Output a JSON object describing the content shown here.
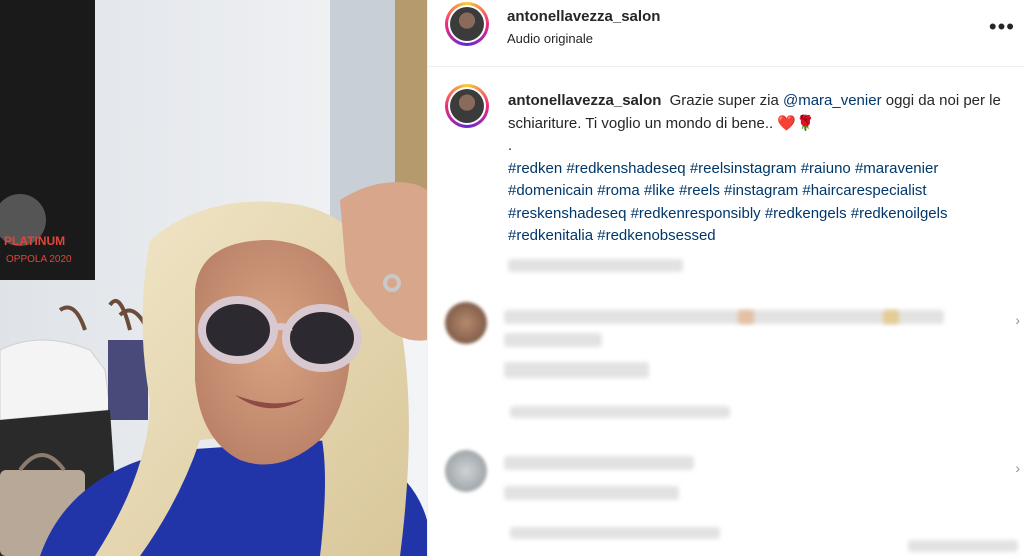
{
  "post": {
    "username": "antonellavezza_salon",
    "subtitle": "Audio originale",
    "more_label": "•••"
  },
  "caption": {
    "username": "antonellavezza_salon",
    "text_1": "Grazie super zia",
    "mention": "@mara_venier",
    "text_2": "oggi da noi per le schiariture. Ti voglio un mondo di bene..",
    "emojis": "❤️🌹",
    "dot": ".",
    "hashtags": [
      "#redken",
      "#redkenshadeseq",
      "#reelsinstagram",
      "#raiuno",
      "#maravenier",
      "#domenicain",
      "#roma",
      "#like",
      "#reels",
      "#instagram",
      "#haircarespecialist",
      "#reskenshadeseq",
      "#redkenresponsibly",
      "#redkengels",
      "#redkenoilgels",
      "#redkenitalia",
      "#redkenobsessed"
    ]
  },
  "poster": {
    "line1": "PLATINUM",
    "line2": "OPPOLA 2020"
  },
  "colors": {
    "link": "#00376b",
    "text": "#262626",
    "sweater": "#2135a8"
  }
}
